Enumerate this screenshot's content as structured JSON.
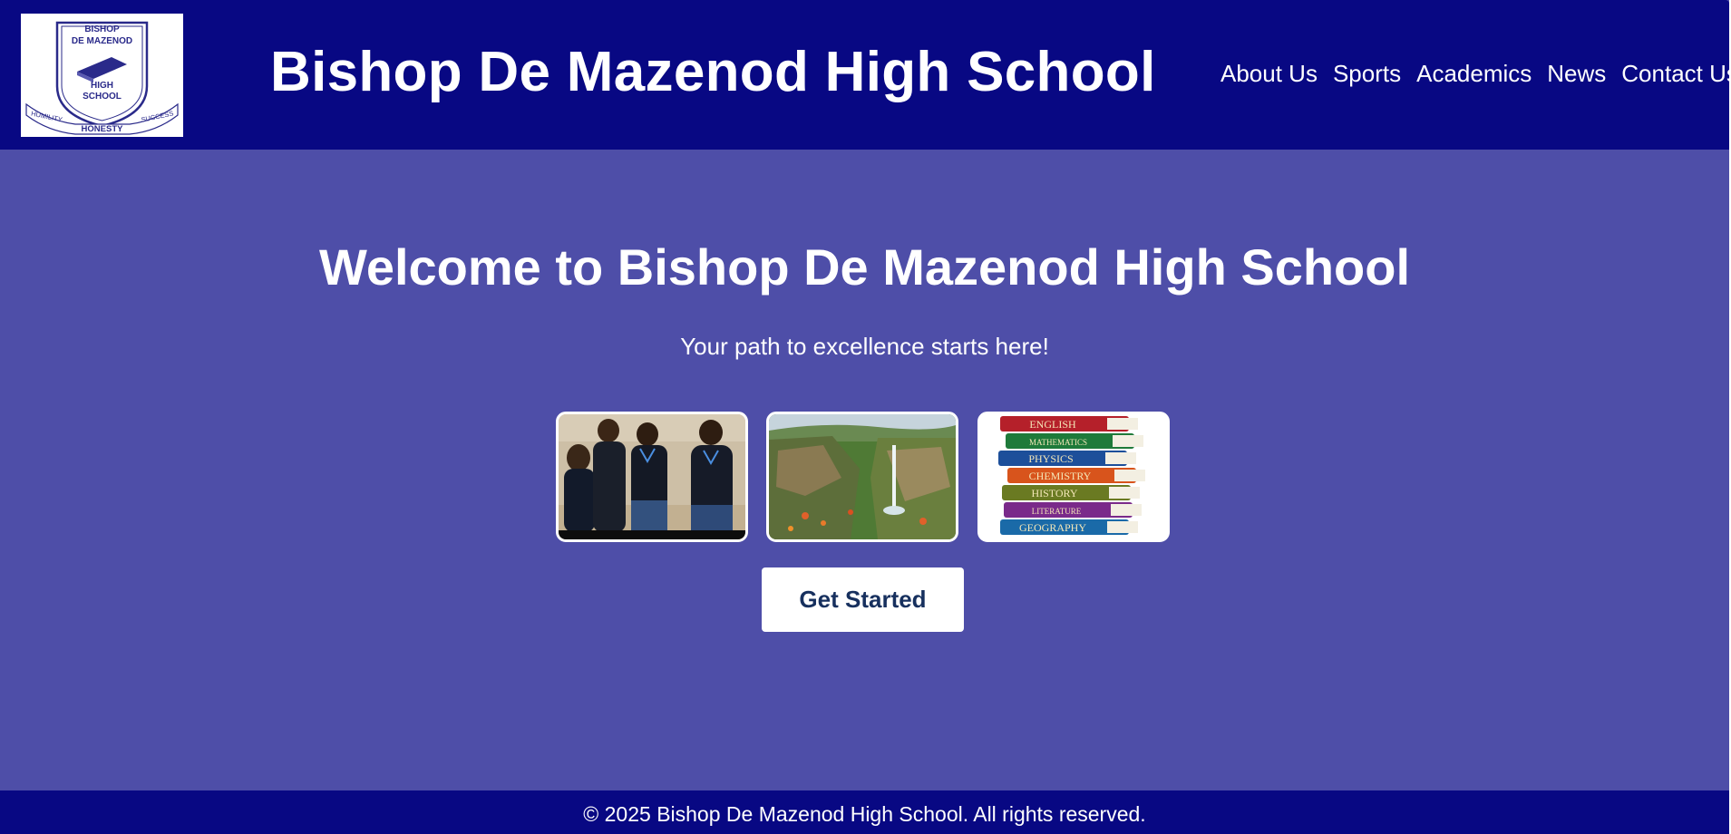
{
  "header": {
    "logo": {
      "alt": "Bishop De Mazenod High School crest",
      "text_line1": "BISHOP",
      "text_line2": "DE MAZENOD",
      "text_line3": "HIGH",
      "text_line4": "SCHOOL",
      "motto_left": "HUMILITY",
      "motto_center": "HONESTY",
      "motto_right": "SUCCESS"
    },
    "title": "Bishop De Mazenod High School",
    "nav": [
      "About Us",
      "Sports",
      "Academics",
      "News",
      "Contact Us"
    ]
  },
  "hero": {
    "title": "Welcome to Bishop De Mazenod High School",
    "subtitle": "Your path to excellence starts here!",
    "cta_label": "Get Started"
  },
  "gallery": {
    "images": [
      {
        "name": "students-photo",
        "alt": "Students in school uniform"
      },
      {
        "name": "waterfall-photo",
        "alt": "Waterfall landscape"
      },
      {
        "name": "books-photo",
        "alt": "Stack of subject textbooks"
      }
    ],
    "book_spines": [
      "ENGLISH",
      "MATHEMATICS",
      "PHYSICS",
      "CHEMISTRY",
      "HISTORY",
      "LITERATURE",
      "GEOGRAPHY"
    ]
  },
  "footer": {
    "text": "© 2025 Bishop De Mazenod High School. All rights reserved."
  },
  "colors": {
    "header_bg": "#080883",
    "page_bg": "#4e4ea8",
    "cta_text": "#17305e",
    "text": "#ffffff"
  }
}
